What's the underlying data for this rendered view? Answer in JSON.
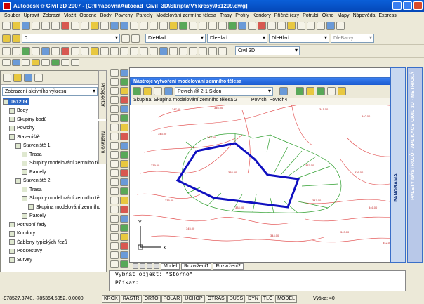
{
  "window": {
    "title": "Autodesk ® Civil 3D 2007 - [C:\\Pracovni\\Autocad_Civil_3D\\Skripta\\VYkresy\\061209.dwg]"
  },
  "menu": [
    "Soubor",
    "Upravit",
    "Zobrazit",
    "Vložit",
    "Obecné",
    "Body",
    "Povrchy",
    "Parcely",
    "Modelování zemního tělesa",
    "Trasy",
    "Profily",
    "Koridory",
    "Příčné řezy",
    "Potrubí",
    "Okno",
    "Mapy",
    "Nápověda",
    "Express"
  ],
  "toolbar": {
    "color_combo": "DleHlad",
    "linetype1": "DleHlad",
    "linetype2": "DleHlad",
    "plotstyle": "DleBarvy",
    "layer_value": "0",
    "workspace": "Civil 3D"
  },
  "prospector": {
    "view_combo": "Zobrazení aktivního výkresu",
    "tab_prospector": "Prospector",
    "tab_settings": "Nastavení",
    "tree": [
      {
        "label": "061209",
        "level": 0,
        "selected": true
      },
      {
        "label": "Body",
        "level": 1
      },
      {
        "label": "Skupiny bodů",
        "level": 1
      },
      {
        "label": "Povrchy",
        "level": 1
      },
      {
        "label": "Staveniště",
        "level": 1
      },
      {
        "label": "Staveniště 1",
        "level": 2
      },
      {
        "label": "Trasa",
        "level": 3
      },
      {
        "label": "Skupiny modelování zemního tě",
        "level": 3
      },
      {
        "label": "Parcely",
        "level": 3
      },
      {
        "label": "Staveniště 2",
        "level": 2
      },
      {
        "label": "Trasa",
        "level": 3
      },
      {
        "label": "Skupiny modelování zemního tě",
        "level": 3
      },
      {
        "label": "Skupina modelování zemního",
        "level": 4
      },
      {
        "label": "Parcely",
        "level": 3
      },
      {
        "label": "Potrubní řady",
        "level": 1
      },
      {
        "label": "Koridory",
        "level": 1
      },
      {
        "label": "Šablony typických řezů",
        "level": 1
      },
      {
        "label": "Podsestavy",
        "level": 1
      },
      {
        "label": "Survey",
        "level": 1
      }
    ]
  },
  "grading_window": {
    "title": "Nástroje vytvoření modelování zemního tělesa",
    "criteria_combo": "Povrch @ 2-1 Sklon",
    "group_label": "Skupina: Skupina modelování zemního tělesa 2",
    "surface_label": "Povrch: Povrch4"
  },
  "layout_tabs": [
    "Model",
    "Rozvržení1",
    "Rozvržení2"
  ],
  "panels": {
    "panorama": "PANORAMA",
    "palety": "PALETY NÁSTROJŮ - APLIKACE CIVIL 3D - METRICKÁ"
  },
  "command_line": {
    "line1": "Vybrat objekt: *Storno*",
    "line2": "Příkaz:"
  },
  "status": {
    "coords": "-978527.3740, -785364.5052, 0.0000",
    "toggles": [
      "KROK",
      "RASTR",
      "ORTO",
      "POLÁR",
      "UCHOP",
      "OTRAS",
      "DUSS",
      "DYN",
      "TLČ",
      "MODEL"
    ],
    "scale": "Výška: ≈0"
  },
  "canvas": {
    "ucs_x": "X",
    "ucs_y": "Y",
    "elevations": [
      "347.00",
      "346.00",
      "345.00",
      "344.00",
      "343.00",
      "342.00",
      "341.00",
      "340.00",
      "339.00",
      "338.00",
      "337.00",
      "336.00",
      "335.00",
      "334.00"
    ]
  }
}
